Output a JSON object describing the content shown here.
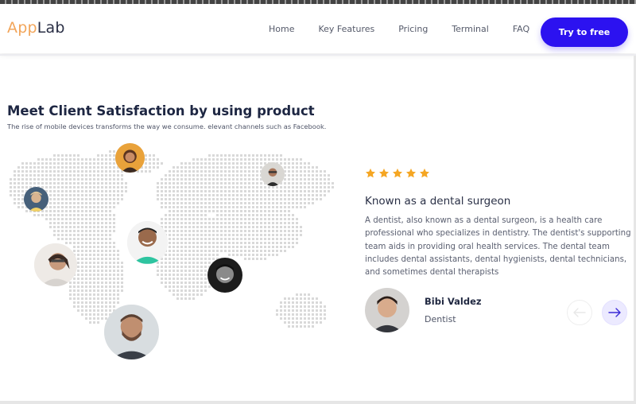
{
  "header": {
    "logo_part1": "App",
    "logo_part2": "Lab",
    "nav": [
      "Home",
      "Key Features",
      "Pricing",
      "Terminal",
      "FAQ"
    ],
    "cta_label": "Try to free"
  },
  "section": {
    "title": "Meet Client Satisfaction by using product",
    "subtitle": "The rise of mobile devices transforms the way we consume. elevant channels such as Facebook."
  },
  "review": {
    "rating": 5,
    "title": "Known as a dental surgeon",
    "text": "A dentist, also known as a dental surgeon, is a health care professional who specializes in dentistry. The dentist's supporting team aids in providing oral health services. The dental team includes dental assistants, dental hygienists, dental technicians, and sometimes dental therapists",
    "reviewer_name": "Bibi Valdez",
    "reviewer_role": "Dentist"
  },
  "colors": {
    "accent": "#2c12f0",
    "logo_orange": "#f2a55a",
    "star": "#f5a623",
    "map_dot": "#d9d9d9"
  },
  "icons": {
    "prev": "arrow-left-icon",
    "next": "arrow-right-icon",
    "star": "star-icon"
  }
}
